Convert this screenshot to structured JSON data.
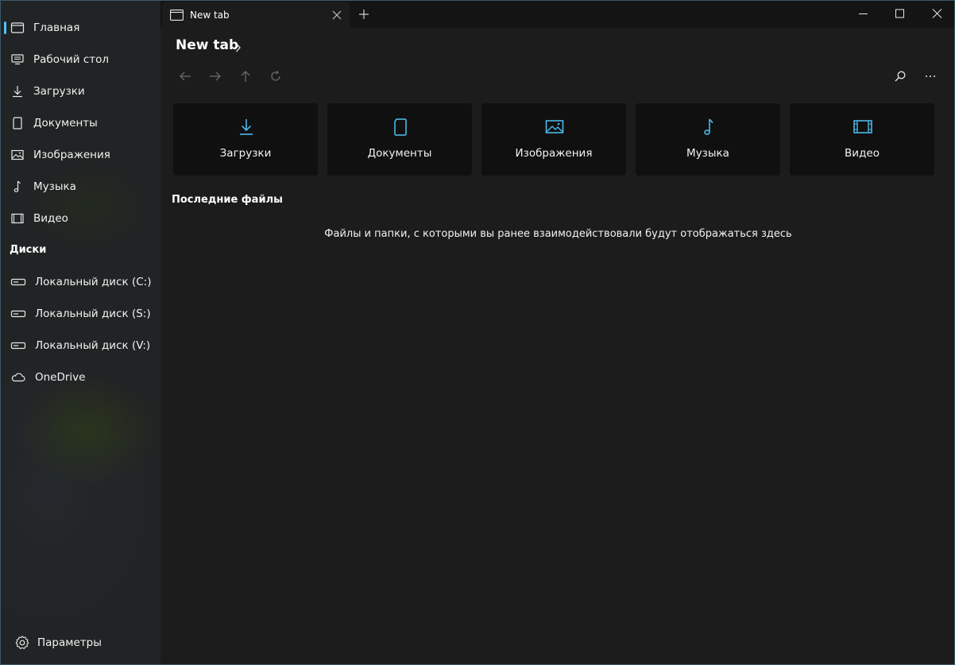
{
  "sidebar": {
    "items": [
      {
        "label": "Главная",
        "icon": "home-icon"
      },
      {
        "label": "Рабочий стол",
        "icon": "desktop-icon"
      },
      {
        "label": "Загрузки",
        "icon": "download-icon"
      },
      {
        "label": "Документы",
        "icon": "document-icon"
      },
      {
        "label": "Изображения",
        "icon": "image-icon"
      },
      {
        "label": "Музыка",
        "icon": "music-icon"
      },
      {
        "label": "Видео",
        "icon": "video-icon"
      }
    ],
    "drives_header": "Диски",
    "drives": [
      {
        "label": "Локальный диск (C:)",
        "icon": "drive-icon"
      },
      {
        "label": "Локальный диск (S:)",
        "icon": "drive-icon"
      },
      {
        "label": "Локальный диск (V:)",
        "icon": "drive-icon"
      },
      {
        "label": "OneDrive",
        "icon": "cloud-icon"
      }
    ],
    "settings_label": "Параметры"
  },
  "tabs": [
    {
      "label": "New tab"
    }
  ],
  "path": {
    "title": "New tab"
  },
  "cards": [
    {
      "label": "Загрузки",
      "icon": "download-icon"
    },
    {
      "label": "Документы",
      "icon": "document-icon"
    },
    {
      "label": "Изображения",
      "icon": "image-icon"
    },
    {
      "label": "Музыка",
      "icon": "music-icon"
    },
    {
      "label": "Видео",
      "icon": "video-icon"
    }
  ],
  "recent": {
    "title": "Последние файлы",
    "empty_text": "Файлы и папки, с которыми вы ранее взаимодействовали будут отображаться здесь"
  },
  "colors": {
    "accent": "#4fc3f7",
    "background": "#1c1c1c",
    "card": "#101010"
  }
}
